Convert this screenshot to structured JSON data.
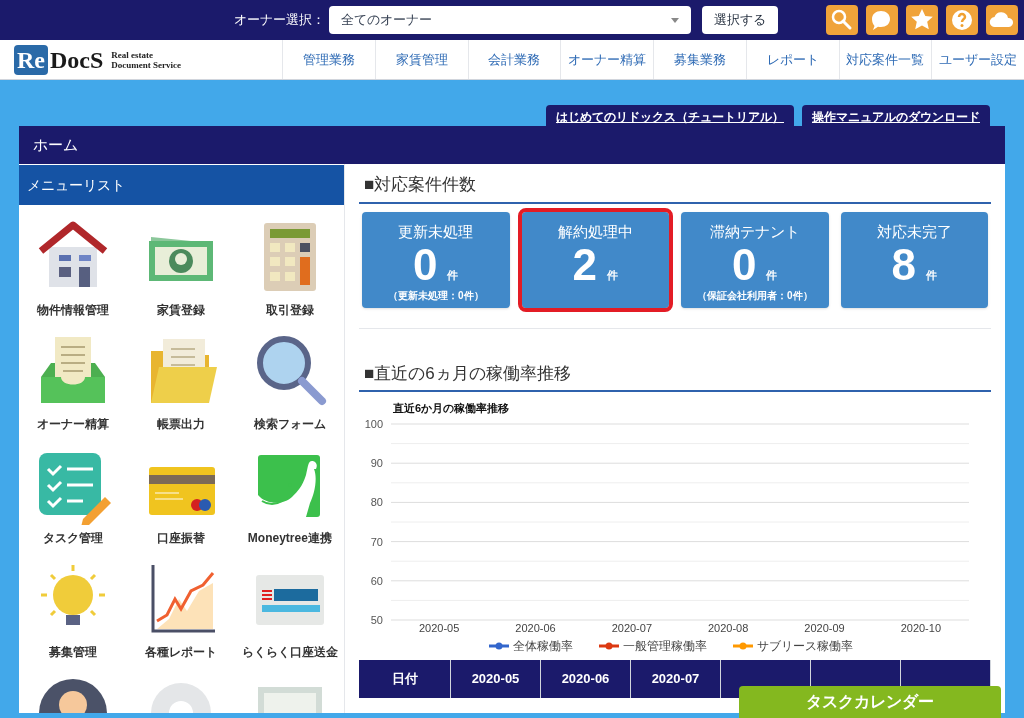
{
  "top_bar": {
    "owner_label": "オーナー選択：",
    "owner_select": {
      "value": "全てのオーナー"
    },
    "select_button": "選択する"
  },
  "logo": {
    "mark_re": "Re",
    "mark_docs": "DocS",
    "tagline_1": "Real estate",
    "tagline_2": "Document Service"
  },
  "nav": [
    "管理業務",
    "家賃管理",
    "会計業務",
    "オーナー精算",
    "募集業務",
    "レポート",
    "対応案件一覧",
    "ユーザー設定"
  ],
  "help_tabs": [
    "はじめてのリドックス（チュートリアル）",
    "操作マニュアルのダウンロード"
  ],
  "panel_title": "ホーム",
  "sidebar": {
    "title": "メニューリスト",
    "items": [
      {
        "label": "物件情報管理"
      },
      {
        "label": "家賃登録"
      },
      {
        "label": "取引登録"
      },
      {
        "label": "オーナー精算"
      },
      {
        "label": "帳票出力"
      },
      {
        "label": "検索フォーム"
      },
      {
        "label": "タスク管理"
      },
      {
        "label": "口座振替"
      },
      {
        "label": "Moneytree連携"
      },
      {
        "label": "募集管理"
      },
      {
        "label": "各種レポート"
      },
      {
        "label": "らくらく口座送金"
      }
    ]
  },
  "cases": {
    "title": "■対応案件件数",
    "cards": [
      {
        "label": "更新未処理",
        "count": "0",
        "unit": "件",
        "note": "（更新未処理：0件）",
        "selected": false
      },
      {
        "label": "解約処理中",
        "count": "2",
        "unit": "件",
        "selected": true
      },
      {
        "label": "滞納テナント",
        "count": "0",
        "unit": "件",
        "note": "（保証会社利用者：0件）",
        "selected": false
      },
      {
        "label": "対応未完了",
        "count": "8",
        "unit": "件",
        "selected": false
      }
    ]
  },
  "occupancy": {
    "title": "■直近の6ヵ月の稼働率推移",
    "chart_data": {
      "type": "line",
      "grid": true,
      "title": "直近6か月の稼働率推移",
      "categories": [
        "2020-05",
        "2020-06",
        "2020-07",
        "2020-08",
        "2020-09",
        "2020-10"
      ],
      "ylim": [
        50,
        100
      ],
      "yticks": [
        50,
        60,
        70,
        80,
        90,
        100
      ],
      "series": [
        {
          "name": "全体稼働率",
          "color": "#3366cc",
          "values": [
            null,
            null,
            null,
            null,
            null,
            null
          ]
        },
        {
          "name": "一般管理稼働率",
          "color": "#dc3912",
          "values": [
            null,
            null,
            null,
            null,
            null,
            null
          ]
        },
        {
          "name": "サブリース稼働率",
          "color": "#ff9900",
          "values": [
            null,
            null,
            null,
            null,
            null,
            null
          ]
        }
      ]
    },
    "table": {
      "columns": [
        "日付",
        "2020-05",
        "2020-06",
        "2020-07"
      ]
    }
  },
  "task_calendar_button": "タスクカレンダー"
}
